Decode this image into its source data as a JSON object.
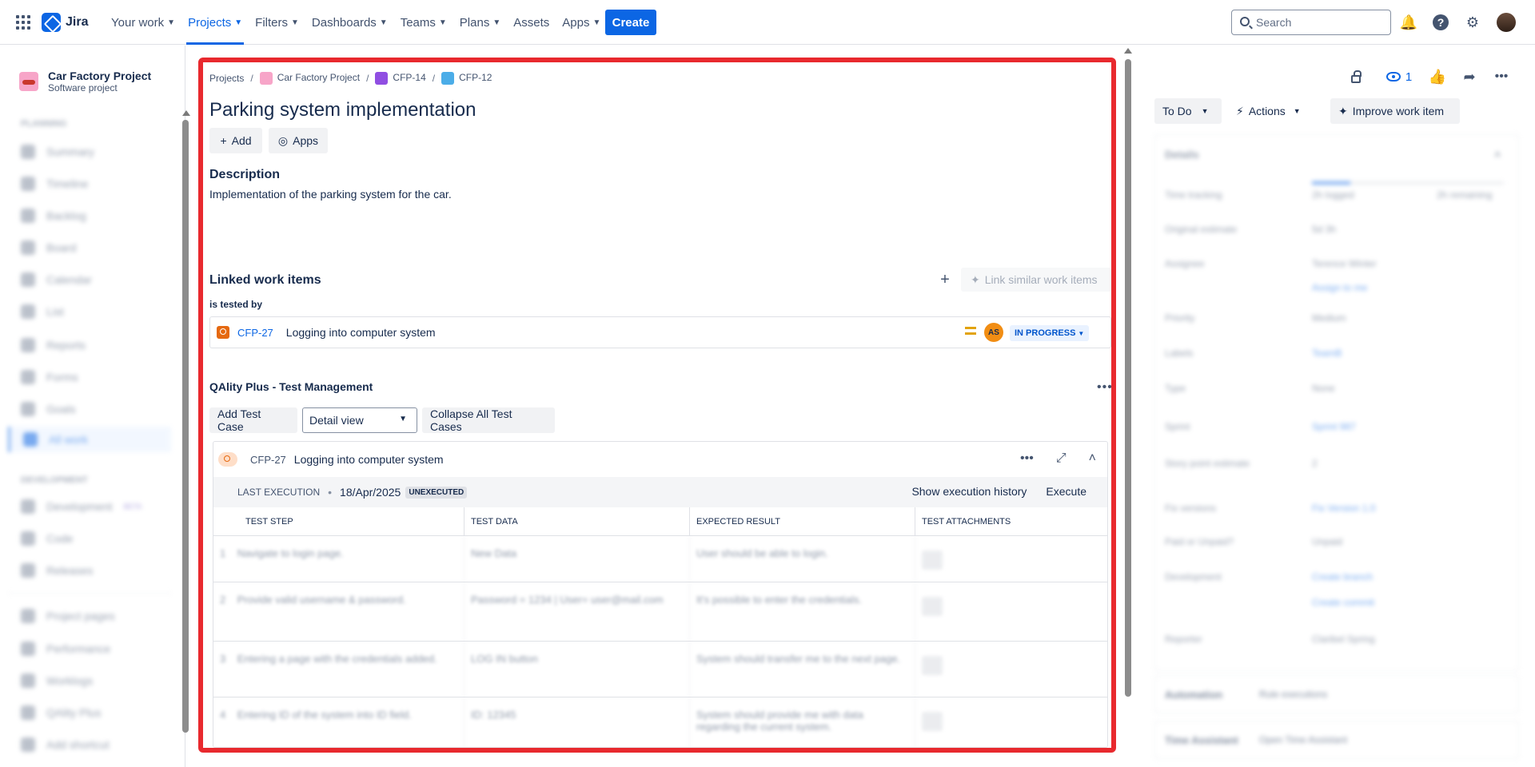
{
  "topbar": {
    "logo_text": "Jira",
    "nav": [
      {
        "label": "Your work"
      },
      {
        "label": "Projects"
      },
      {
        "label": "Filters"
      },
      {
        "label": "Dashboards"
      },
      {
        "label": "Teams"
      },
      {
        "label": "Plans"
      },
      {
        "label": "Assets"
      },
      {
        "label": "Apps"
      }
    ],
    "create_label": "Create",
    "search_placeholder": "Search"
  },
  "sidebar": {
    "project_name": "Car Factory Project",
    "project_type": "Software project",
    "section_planning": "PLANNING",
    "planning_items": [
      "Summary",
      "Timeline",
      "Backlog",
      "Board",
      "Calendar",
      "List",
      "Reports",
      "Forms",
      "Goals",
      "All work"
    ],
    "section_development": "DEVELOPMENT",
    "development_items": [
      "Development",
      "Code",
      "Releases"
    ],
    "development_badge": "BETA",
    "bottom_items": [
      "Project pages",
      "Performance",
      "Worklogs",
      "QAlity Plus",
      "Add shortcut"
    ]
  },
  "breadcrumb": {
    "projects": "Projects",
    "project": "Car Factory Project",
    "epic": "CFP-14",
    "item": "CFP-12"
  },
  "issue": {
    "title": "Parking system implementation",
    "add_label": "Add",
    "apps_label": "Apps",
    "description_heading": "Description",
    "description_text": "Implementation of the parking system for the car."
  },
  "linked": {
    "heading": "Linked work items",
    "link_similar_label": "Link similar work items",
    "relation": "is tested by",
    "items": [
      {
        "key": "CFP-27",
        "title": "Logging into computer system",
        "assignee_initials": "AS",
        "status": "IN PROGRESS"
      }
    ]
  },
  "qality": {
    "title": "QAlity Plus - Test Management",
    "add_test_case_label": "Add Test Case",
    "view_select_value": "Detail view",
    "collapse_label": "Collapse All Test Cases",
    "test_case": {
      "key": "CFP-27",
      "title": "Logging into computer system",
      "last_execution_label": "LAST EXECUTION",
      "last_execution_date": "18/Apr/2025",
      "execution_status": "UNEXECUTED",
      "history_label": "Show execution history",
      "execute_label": "Execute",
      "columns": [
        "TEST STEP",
        "TEST DATA",
        "EXPECTED RESULT",
        "TEST ATTACHMENTS"
      ],
      "steps": [
        {
          "n": "1",
          "step": "Navigate to login page.",
          "data": "New Data",
          "expected": "User should be able to login."
        },
        {
          "n": "2",
          "step": "Provide valid username & password.",
          "data": "Password = 1234 | User= user@mail.com",
          "expected": "It's possible to enter the credentials."
        },
        {
          "n": "3",
          "step": "Entering a page with the credentials added.",
          "data": "LOG IN button",
          "expected": "System should transfer me to the next page."
        },
        {
          "n": "4",
          "step": "Entering ID of the system into ID field.",
          "data": "ID: 12345",
          "expected": "System should provide me with data regarding the current system."
        }
      ]
    }
  },
  "right_panel": {
    "watch_count": "1",
    "status_label": "To Do",
    "actions_label": "Actions",
    "improve_label": "Improve work item",
    "details_heading": "Details",
    "fields": [
      {
        "label": "Time tracking",
        "value": "2h logged"
      },
      {
        "label": "Original estimate",
        "value": "5d 3h"
      },
      {
        "label": "Assignee",
        "value": "Terence Winter"
      },
      {
        "label": "",
        "value": "Assign to me"
      },
      {
        "label": "Priority",
        "value": "Medium"
      },
      {
        "label": "Labels",
        "value": "TeamB"
      },
      {
        "label": "Type",
        "value": "None"
      },
      {
        "label": "Sprint",
        "value": "Sprint 987"
      },
      {
        "label": "Story point estimate",
        "value": "2"
      },
      {
        "label": "Fix versions",
        "value": "Fix Version 1.0"
      },
      {
        "label": "Paid or Unpaid?",
        "value": "Unpaid"
      },
      {
        "label": "Development",
        "value": "Create branch"
      },
      {
        "label": "",
        "value": "Create commit"
      },
      {
        "label": "Reporter",
        "value": "Claribel Spring"
      }
    ],
    "time_remaining": "2h remaining",
    "automation_label": "Automation",
    "automation_value": "Rule executions",
    "time_assistant_label": "Time Assistant",
    "time_assistant_value": "Open Time Assistant"
  }
}
